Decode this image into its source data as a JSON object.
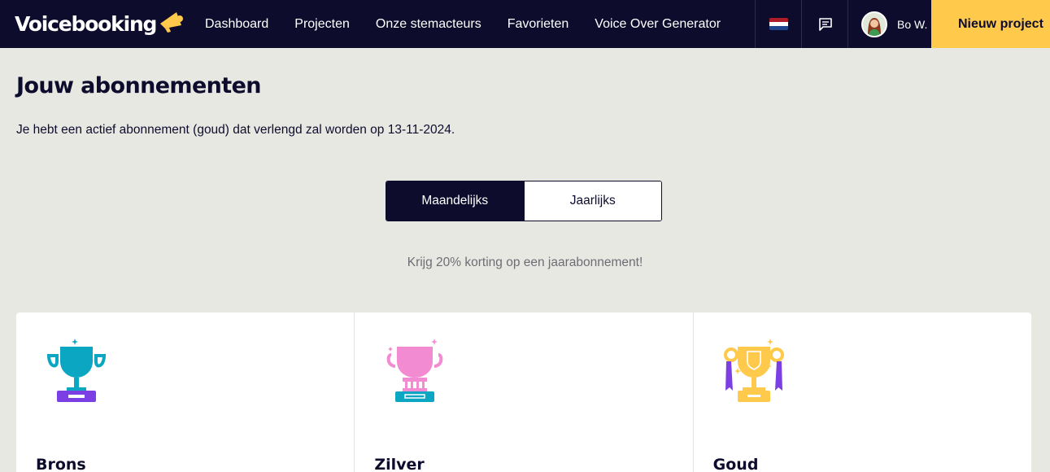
{
  "header": {
    "logo_text": "Voicebooking",
    "nav": [
      "Dashboard",
      "Projecten",
      "Onze stemacteurs",
      "Favorieten",
      "Voice Over Generator"
    ],
    "flag_icon": "flag-nl-icon",
    "chat_icon": "chat-icon",
    "user_name": "Bo W.",
    "new_project_label": "Nieuw project",
    "colors": {
      "bar": "#0d0c2c",
      "accent": "#ffc94b"
    }
  },
  "page": {
    "title": "Jouw abonnementen",
    "subscription_info": "Je hebt een actief abonnement (goud) dat verlengd zal worden op 13-11-2024."
  },
  "billing_toggle": {
    "monthly_label": "Maandelijks",
    "yearly_label": "Jaarlijks",
    "selected": "Maandelijks"
  },
  "promo_text": "Krijg 20% korting op een jaarabonnement!",
  "plans": [
    {
      "name": "Brons",
      "icon": "trophy-blue-icon"
    },
    {
      "name": "Zilver",
      "icon": "trophy-pink-icon"
    },
    {
      "name": "Goud",
      "icon": "trophy-gold-icon"
    }
  ]
}
